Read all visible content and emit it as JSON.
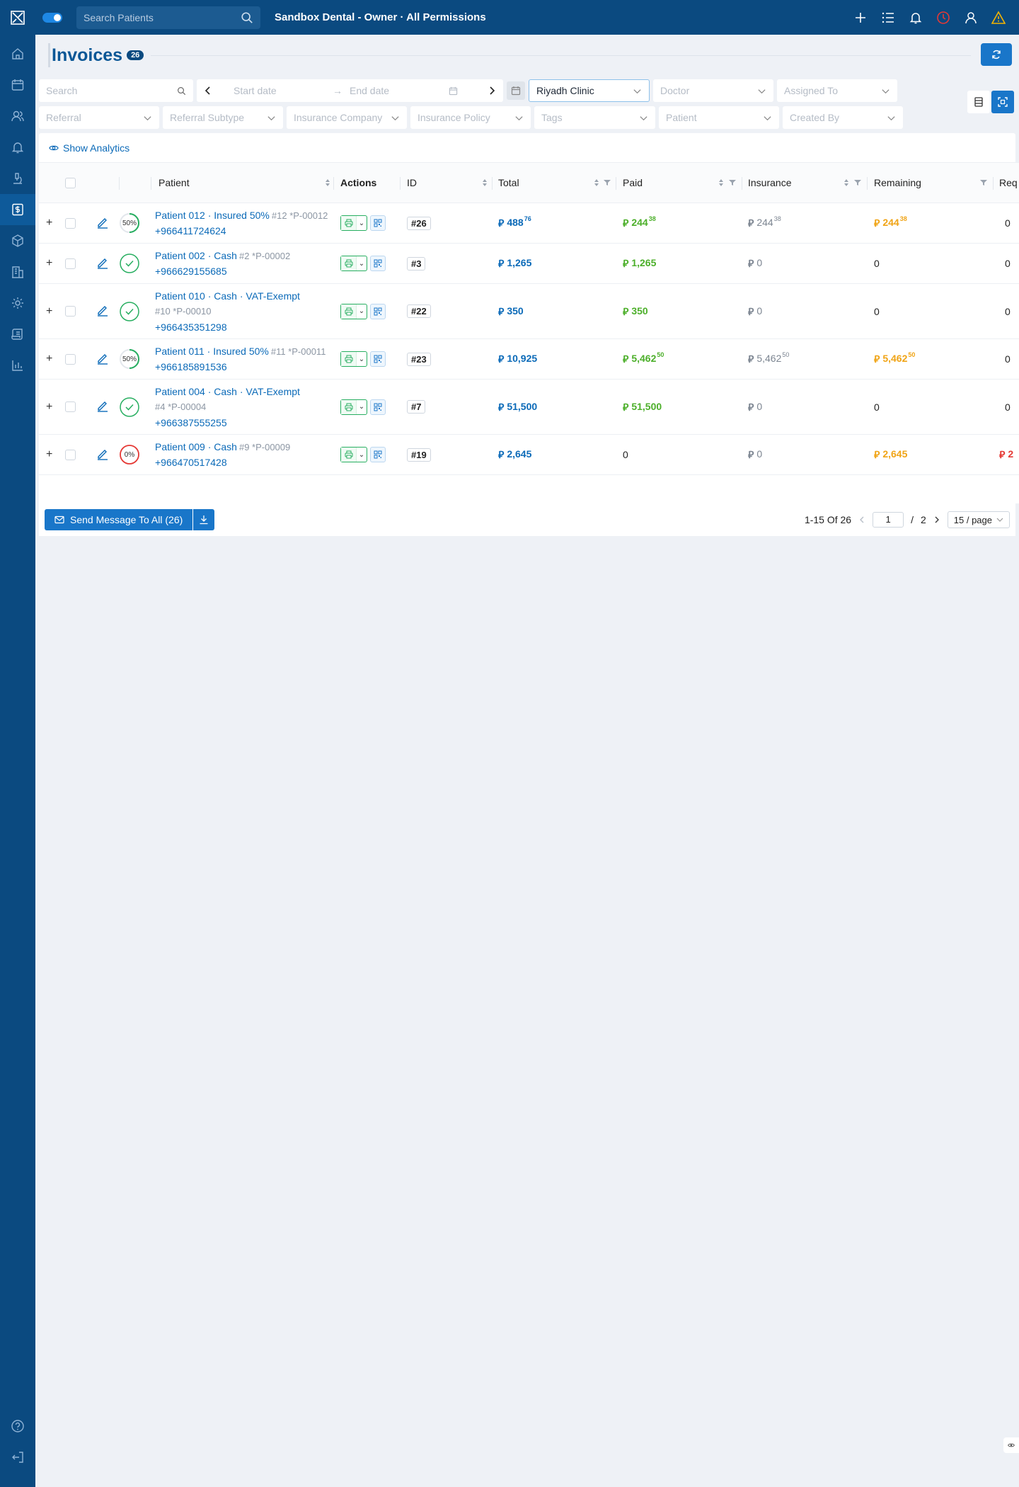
{
  "header": {
    "search_placeholder": "Search Patients",
    "title": "Sandbox Dental - Owner · All Permissions"
  },
  "page": {
    "title": "Invoices",
    "count_badge": "26"
  },
  "filters": {
    "search_placeholder": "Search",
    "start_date_placeholder": "Start date",
    "end_date_placeholder": "End date",
    "clinic": "Riyadh Clinic",
    "doctor": "Doctor",
    "assigned_to": "Assigned To",
    "referral": "Referral",
    "referral_subtype": "Referral Subtype",
    "insurance_company": "Insurance Company",
    "insurance_policy": "Insurance Policy",
    "tags": "Tags",
    "patient": "Patient",
    "created_by": "Created By"
  },
  "analytics_label": "Show Analytics",
  "columns": {
    "patient": "Patient",
    "actions": "Actions",
    "id": "ID",
    "total": "Total",
    "paid": "Paid",
    "insurance": "Insurance",
    "remaining": "Remaining",
    "req": "Req"
  },
  "currency_symbol": "⃁",
  "rows": [
    {
      "status": "50%",
      "status_type": "partial",
      "name": "Patient 012 · Insured 50%",
      "sub_inline": "#12 *P-00012",
      "sub_block": "",
      "phone": "+966411724624",
      "id": "#26",
      "total": "488",
      "total_dec": "76",
      "paid": "244",
      "paid_dec": "38",
      "insurance": "244",
      "insurance_dec": "38",
      "remaining": "244",
      "remaining_dec": "38",
      "remaining_cur": true,
      "req": "0"
    },
    {
      "status": "",
      "status_type": "paid",
      "name": "Patient 002 · Cash",
      "sub_inline": "#2 *P-00002",
      "sub_block": "",
      "phone": "+966629155685",
      "id": "#3",
      "total": "1,265",
      "total_dec": "",
      "paid": "1,265",
      "paid_dec": "",
      "insurance": "0",
      "insurance_dec": "",
      "remaining": "0",
      "remaining_dec": "",
      "remaining_cur": false,
      "req": "0"
    },
    {
      "status": "",
      "status_type": "paid",
      "name": "Patient 010 · Cash · VAT-Exempt",
      "sub_inline": "",
      "sub_block": "#10 *P-00010",
      "phone": "+966435351298",
      "id": "#22",
      "total": "350",
      "total_dec": "",
      "paid": "350",
      "paid_dec": "",
      "insurance": "0",
      "insurance_dec": "",
      "remaining": "0",
      "remaining_dec": "",
      "remaining_cur": false,
      "req": "0"
    },
    {
      "status": "50%",
      "status_type": "partial",
      "name": "Patient 011 · Insured 50%",
      "sub_inline": "#11 *P-00011",
      "sub_block": "",
      "phone": "+966185891536",
      "id": "#23",
      "total": "10,925",
      "total_dec": "",
      "paid": "5,462",
      "paid_dec": "50",
      "insurance": "5,462",
      "insurance_dec": "50",
      "remaining": "5,462",
      "remaining_dec": "50",
      "remaining_cur": true,
      "req": "0"
    },
    {
      "status": "",
      "status_type": "paid",
      "name": "Patient 004 · Cash · VAT-Exempt",
      "sub_inline": "",
      "sub_block": "#4 *P-00004",
      "phone": "+966387555255",
      "id": "#7",
      "total": "51,500",
      "total_dec": "",
      "paid": "51,500",
      "paid_dec": "",
      "insurance": "0",
      "insurance_dec": "",
      "remaining": "0",
      "remaining_dec": "",
      "remaining_cur": false,
      "req": "0"
    },
    {
      "status": "0%",
      "status_type": "unpaid",
      "name": "Patient 009 · Cash",
      "sub_inline": "#9 *P-00009",
      "sub_block": "",
      "phone": "+966470517428",
      "id": "#19",
      "total": "2,645",
      "total_dec": "",
      "paid": "0",
      "paid_dec": "",
      "insurance": "0",
      "insurance_dec": "",
      "remaining": "2,645",
      "remaining_dec": "",
      "remaining_cur": true,
      "req": "2"
    }
  ],
  "footer": {
    "send_label": "Send Message To All (26)",
    "range": "1-15 Of 26",
    "current_page": "1",
    "total_pages": "2",
    "page_size": "15 / page"
  },
  "colors": {
    "header_bg": "#0b4a80",
    "primary": "#1976c9",
    "link": "#0b6ab8",
    "paid_green": "#4caf2a",
    "remaining_orange": "#f0a416",
    "danger": "#e53935"
  }
}
